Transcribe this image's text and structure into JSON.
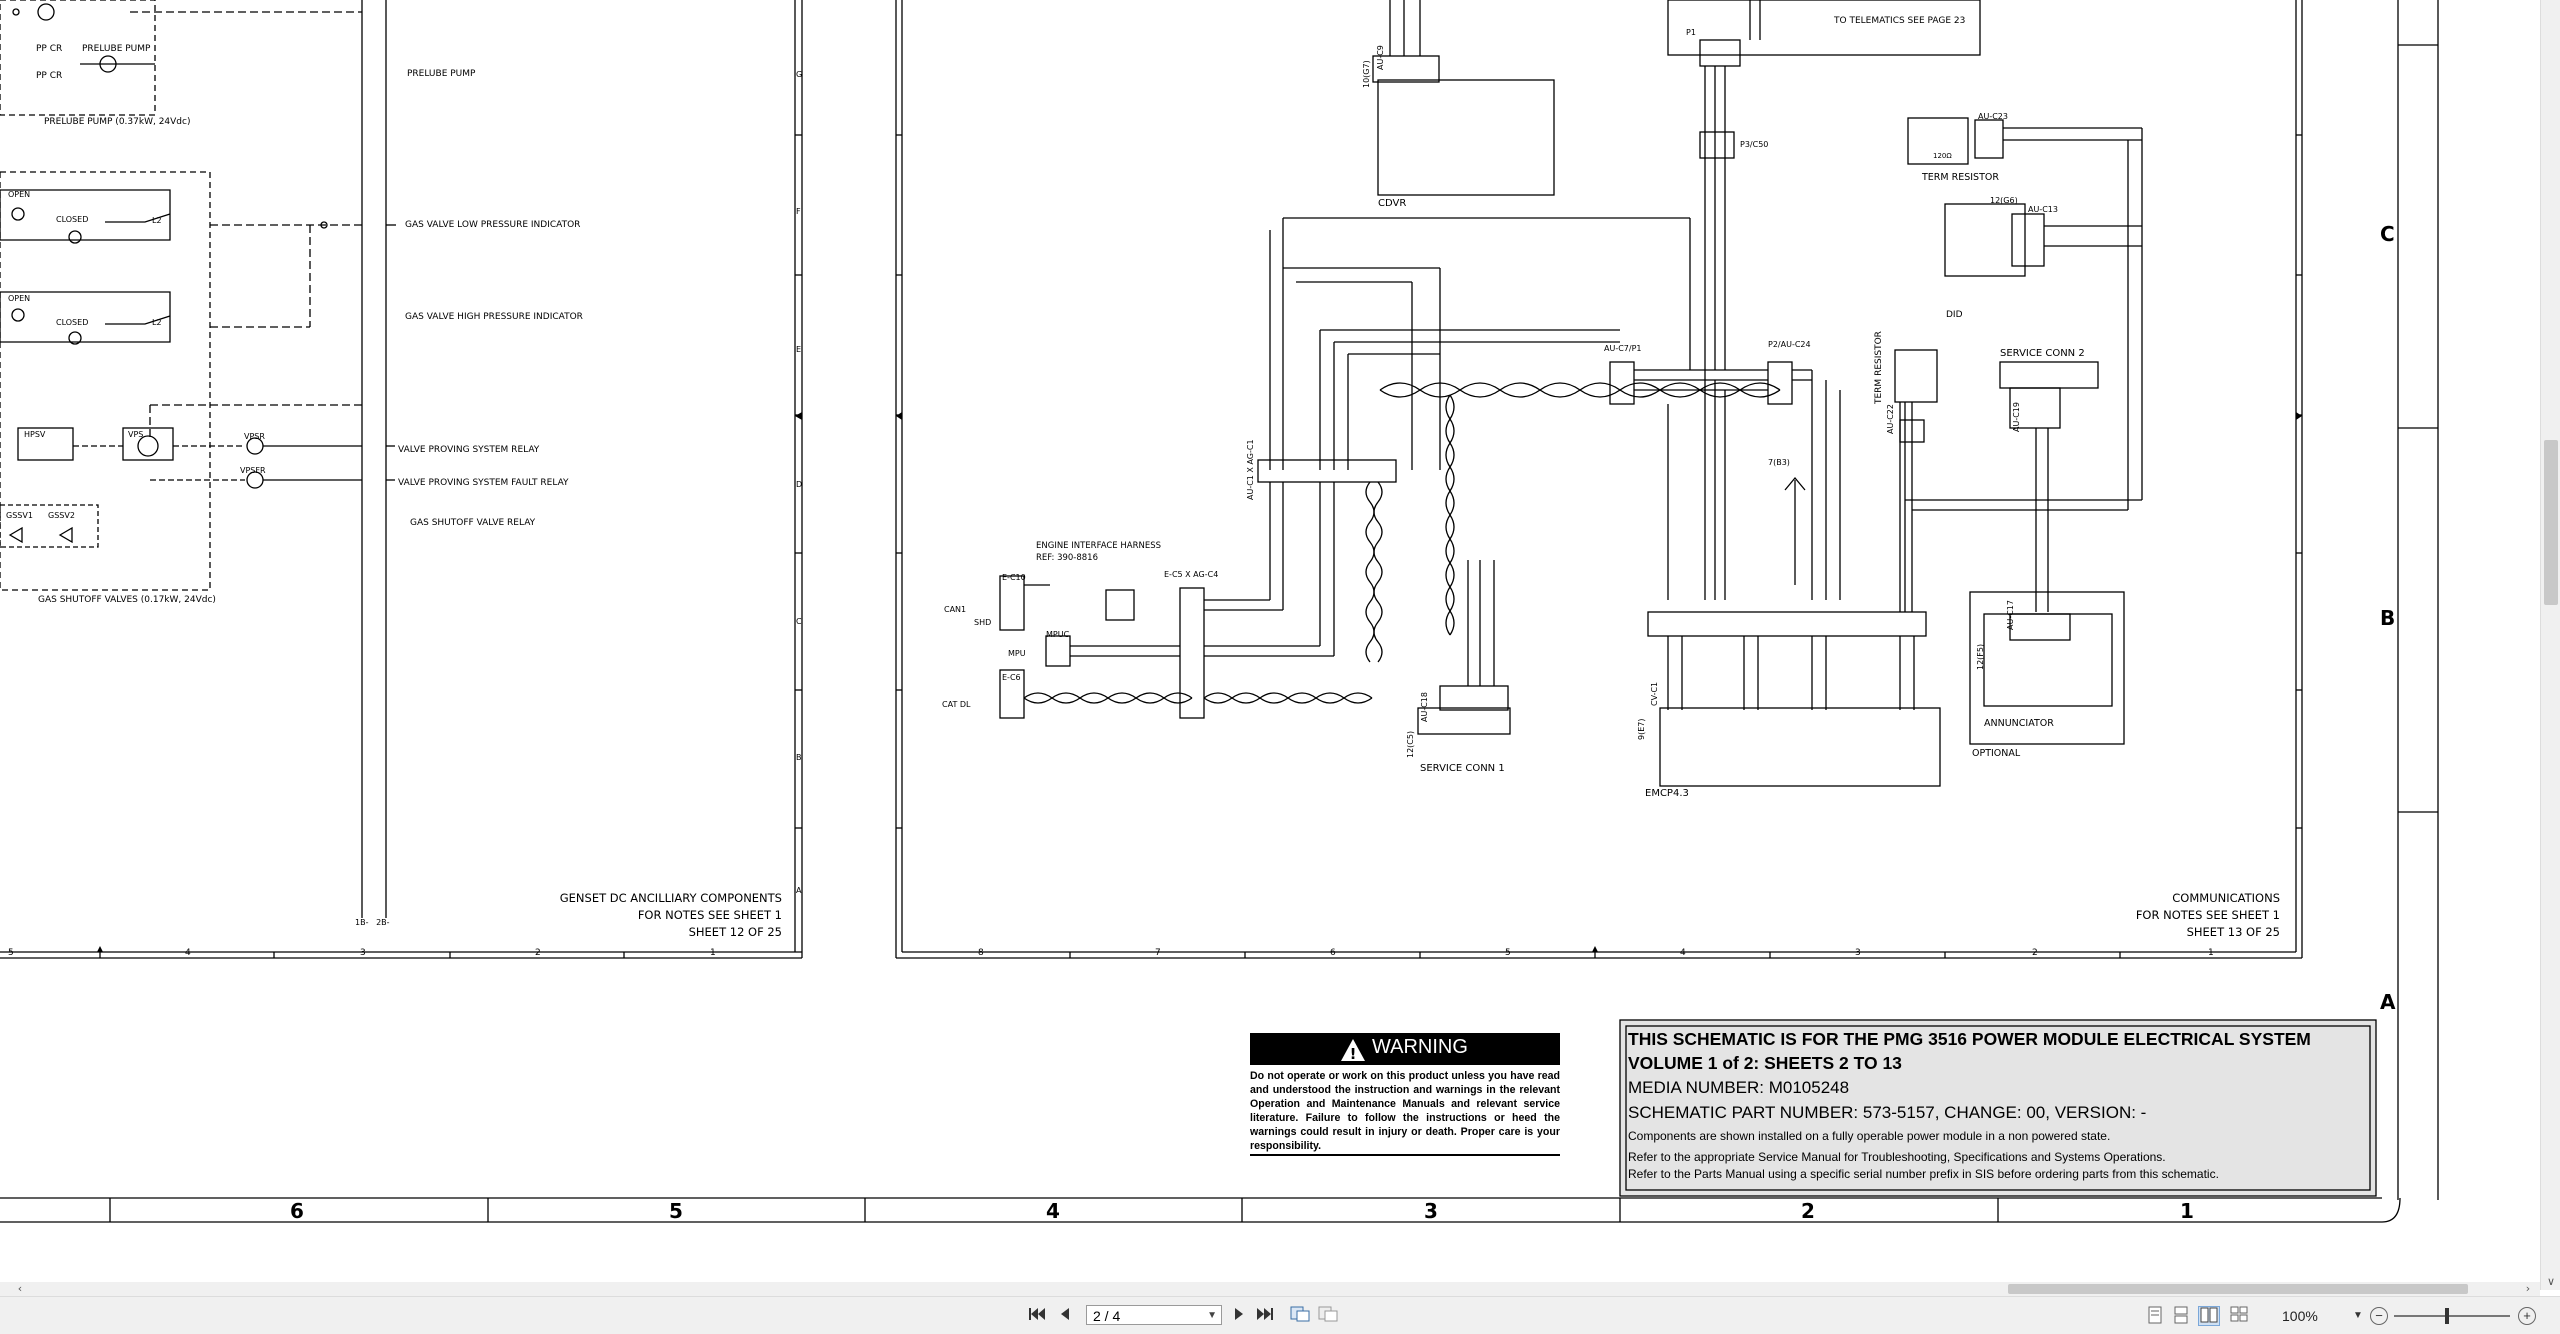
{
  "left_sheet": {
    "title_lines": [
      "GENSET DC ANCILLIARY COMPONENTS",
      "FOR NOTES SEE SHEET 1",
      "SHEET 12 OF 25"
    ],
    "labels": {
      "prelube_pump": "PRELUBE PUMP",
      "prelube_pump_spec": "PRELUBE PUMP (0.37kW, 24Vdc)",
      "gas_low": "GAS VALVE LOW PRESSURE INDICATOR",
      "gas_high": "GAS VALVE HIGH PRESSURE INDICATOR",
      "vps_relay": "VALVE PROVING SYSTEM RELAY",
      "vps_fault": "VALVE PROVING SYSTEM FAULT RELAY",
      "shutoff_relay": "GAS SHUTOFF VALVE RELAY",
      "shutoff_valves": "GAS SHUTOFF VALVES (0.17kW, 24Vdc)",
      "pp_cr": "PP CR",
      "prelube_pump_sym": "PRELUBE PUMP",
      "open": "OPEN",
      "closed": "CLOSED",
      "gn": "GN",
      "l2": "L2",
      "hpsv": "HPSV",
      "vps": "VPS",
      "vpsr": "VPSR",
      "vpsfr": "VPSFR",
      "gssv1": "GSSV1",
      "gssv2": "GSSV2",
      "bus_bottom": "1B-   2B-"
    },
    "zone_numbers": [
      "5",
      "4",
      "3",
      "2",
      "1"
    ],
    "zone_letters": [
      "G",
      "F",
      "E",
      "D",
      "C",
      "B",
      "A"
    ]
  },
  "right_sheet": {
    "title_lines": [
      "COMMUNICATIONS",
      "FOR NOTES SEE SHEET 1",
      "SHEET 13 OF 25"
    ],
    "labels": {
      "telematics": "TO TELEMATICS SEE PAGE 23",
      "p1": "P1",
      "p3_c50": "P3/C50",
      "cdvr": "CDVR",
      "au_c9": "AU-C9",
      "term_resistor": "TERM RESISTOR",
      "au_c23": "AU-C23",
      "au_c13": "AU-C13",
      "did": "DID",
      "did_ref": "12(G6)",
      "au_c7_p1": "AU-C7/P1",
      "p2_au_c24": "P2/AU-C24",
      "service_conn_2": "SERVICE CONN 2",
      "au_c19": "AU-C19",
      "au_c22": "AU-C22",
      "engine_harness": "ENGINE INTERFACE HARNESS",
      "engine_harness_ref": "REF: 390-8816",
      "e_c10": "E-C10",
      "e_c5_ag_c4": "E-C5 X AG-C4",
      "e_c6": "E-C6",
      "mpuc": "MPUC",
      "can1": "CAN1",
      "shd": "SHD",
      "mpu": "MPU",
      "cat_dl": "CAT DL",
      "au_c1_ag_c1": "AU-C1 X AG-C1",
      "au_c18": "AU-C18",
      "service_conn_1": "SERVICE CONN 1",
      "service_conn_1_ref": "12(C5)",
      "cv_c1": "CV-C1",
      "emcp": "EMCP4.3",
      "emcp_ref": "9(E7)",
      "au_c17": "AU-C17",
      "annunciator": "ANNUNCIATOR",
      "annunciator_ref": "12(F5)",
      "optional": "OPTIONAL",
      "ref_7b3": "7(B3)",
      "term_resistor_2": "TERM RESISTOR",
      "res_val": "120Ω",
      "cdvr_ref": "10(G7)"
    },
    "zone_numbers": [
      "8",
      "7",
      "6",
      "5",
      "4",
      "3",
      "2",
      "1"
    ]
  },
  "outer_frame": {
    "zone_numbers": [
      "6",
      "5",
      "4",
      "3",
      "2",
      "1"
    ],
    "zone_letters": [
      "C",
      "B",
      "A"
    ]
  },
  "warning": {
    "title": "WARNING",
    "body": "Do not operate or work on this product unless you have read and understood the instruction and warnings in the relevant Operation and Maintenance Manuals and relevant service literature. Failure to follow the instructions or heed the warnings could result in injury or death. Proper care is your responsibility."
  },
  "info_box": {
    "line1": "THIS SCHEMATIC IS FOR THE PMG 3516 POWER MODULE ELECTRICAL SYSTEM",
    "line2": "VOLUME 1 of 2: SHEETS 2 TO 13",
    "line3": "MEDIA NUMBER: M0105248",
    "line4": "SCHEMATIC PART NUMBER: 573-5157, CHANGE: 00, VERSION: -",
    "line5": "Components are shown installed on a fully operable power module in a non powered state.",
    "line6": "Refer to the appropriate Service Manual for Troubleshooting, Specifications and Systems Operations.",
    "line7": "Refer to the Parts Manual using a specific serial number prefix in SIS before ordering parts from this schematic."
  },
  "toolbar": {
    "page_value": "2 / 4",
    "zoom_value": "100%",
    "first_page": "first-page-icon",
    "prev_page": "prev-page-icon",
    "next_page": "next-page-icon",
    "last_page": "last-page-icon",
    "zoom_out": "−",
    "zoom_in": "+"
  }
}
